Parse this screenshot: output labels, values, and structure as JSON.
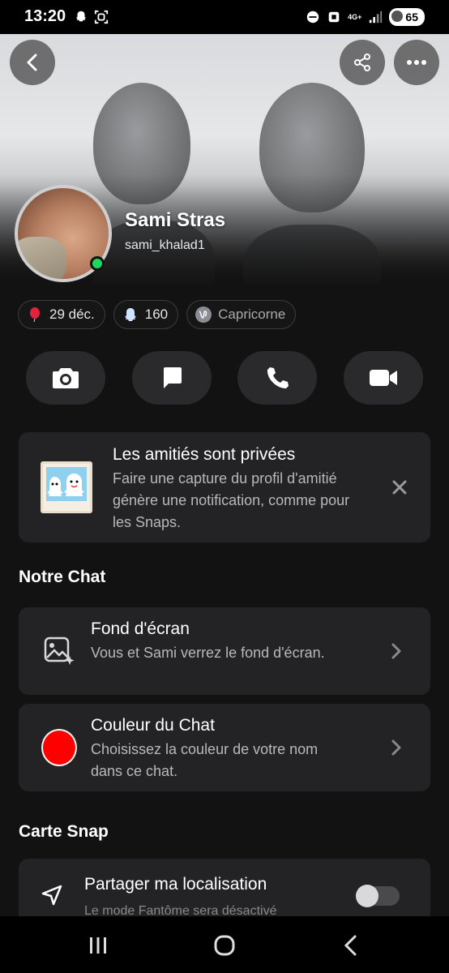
{
  "status_bar": {
    "time": "13:20",
    "network": "4G+",
    "battery": "65",
    "icons": [
      "snapchat-ghost-icon",
      "screenshot-icon",
      "dnd-icon",
      "nfc-icon",
      "signal-icon",
      "battery-icon"
    ]
  },
  "profile": {
    "display_name": "Sami Stras",
    "username": "sami_khalad1",
    "online": true
  },
  "pills": [
    {
      "icon": "balloon-icon",
      "label": "29 déc."
    },
    {
      "icon": "snapstreak-ghost-icon",
      "label": "160"
    },
    {
      "icon": "capricorn-icon",
      "label": "Capricorne"
    }
  ],
  "actions": [
    "camera-icon",
    "chat-icon",
    "phone-icon",
    "video-icon"
  ],
  "privacy_card": {
    "title": "Les amitiés sont privées",
    "description": "Faire une capture du profil d'amitié génère une notification, comme pour les Snaps."
  },
  "notre_chat": {
    "section_title": "Notre Chat",
    "wallpaper": {
      "title": "Fond d'écran",
      "description": "Vous et Sami verrez le fond d'écran."
    },
    "chat_color": {
      "title": "Couleur du Chat",
      "description": "Choisissez la couleur de votre nom dans ce chat.",
      "color": "#ff0000"
    }
  },
  "carte_snap": {
    "section_title": "Carte Snap",
    "share_location": {
      "title": "Partager ma localisation",
      "description": "Le mode Fantôme sera désactivé",
      "enabled": false
    }
  },
  "colors": {
    "background": "#121212",
    "card": "#232325",
    "online": "#1dd75e"
  }
}
